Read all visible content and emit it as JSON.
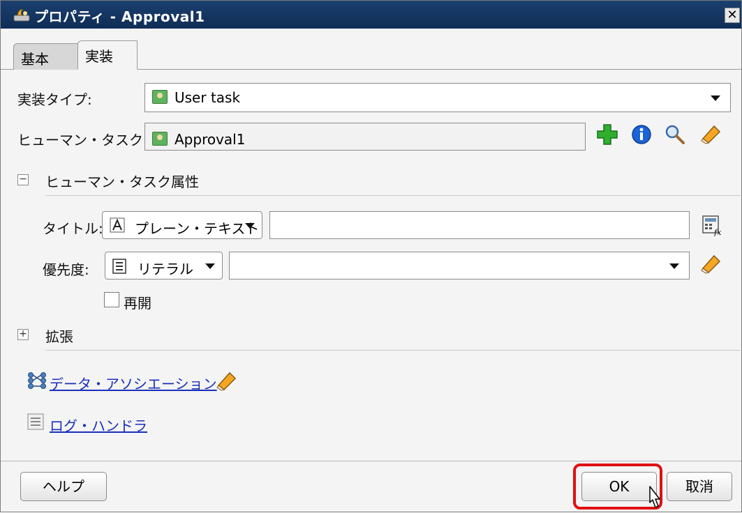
{
  "window": {
    "title": "プロパティ - Approval1",
    "close_glyph": "✕"
  },
  "tabs": [
    {
      "label": "基本",
      "selected": false
    },
    {
      "label": "実装",
      "selected": true
    }
  ],
  "implementation": {
    "type_label": "実装タイプ:",
    "type_value": "User task",
    "human_task_label": "ヒューマン・タスク:",
    "human_task_value": "Approval1"
  },
  "human_task_attributes": {
    "section_label": "ヒューマン・タスク属性",
    "expanded": true,
    "title_label": "タイトル:",
    "title_mode": "プレーン・テキスト",
    "title_value": "",
    "priority_label": "優先度:",
    "priority_mode": "リテラル",
    "priority_value": "",
    "reopen_label": "再開",
    "reopen_checked": false
  },
  "extension": {
    "section_label": "拡張",
    "expanded": false
  },
  "links": {
    "data_association": "データ・アソシエーション",
    "log_handler": "ログ・ハンドラ"
  },
  "buttons": {
    "help": "ヘルプ",
    "ok": "OK",
    "cancel": "取消"
  },
  "colors": {
    "titlebar": "#123562",
    "link": "#1a2fb8",
    "highlight": "#e01010",
    "add_icon": "#2fae2f",
    "info_icon": "#1c63d6"
  }
}
